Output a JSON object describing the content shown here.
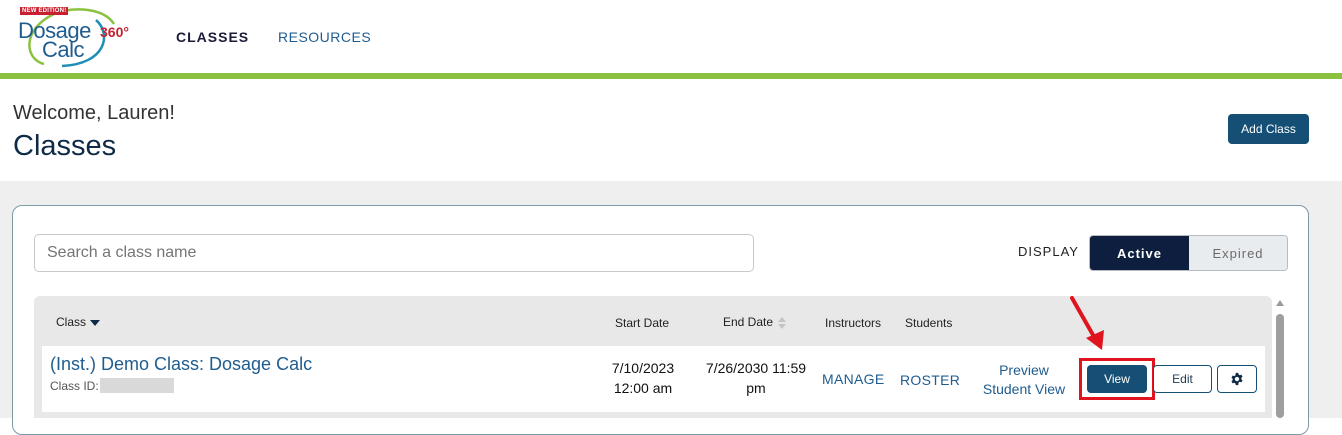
{
  "logo": {
    "badge": "NEW EDITION!",
    "line1": "Dosage",
    "line2": "Calc",
    "number": "360°"
  },
  "nav": {
    "classes": "CLASSES",
    "resources": "RESOURCES"
  },
  "header": {
    "welcome": "Welcome, Lauren!",
    "title": "Classes",
    "add_class": "Add Class"
  },
  "filters": {
    "search_placeholder": "Search a class name",
    "display_label": "DISPLAY",
    "active": "Active",
    "expired": "Expired"
  },
  "table": {
    "columns": {
      "class": "Class",
      "start": "Start Date",
      "end": "End Date",
      "instructors": "Instructors",
      "students": "Students"
    },
    "rows": [
      {
        "name": "(Inst.) Demo Class: Dosage Calc",
        "class_id_label": "Class ID:",
        "start_line1": "7/10/2023",
        "start_line2": "12:00 am",
        "end_line1": "7/26/2030 11:59",
        "end_line2": "pm",
        "manage": "MANAGE",
        "roster": "ROSTER",
        "preview_line1": "Preview",
        "preview_line2": "Student View",
        "view": "View",
        "edit": "Edit"
      }
    ]
  },
  "colors": {
    "accent_green": "#8cc13f",
    "primary_blue": "#154f75",
    "highlight_red": "#e0141e"
  },
  "icons": {
    "sort_class": "caret-down-icon",
    "sort_end": "sort-icon",
    "settings": "gear-icon",
    "annotation": "arrow-icon"
  }
}
